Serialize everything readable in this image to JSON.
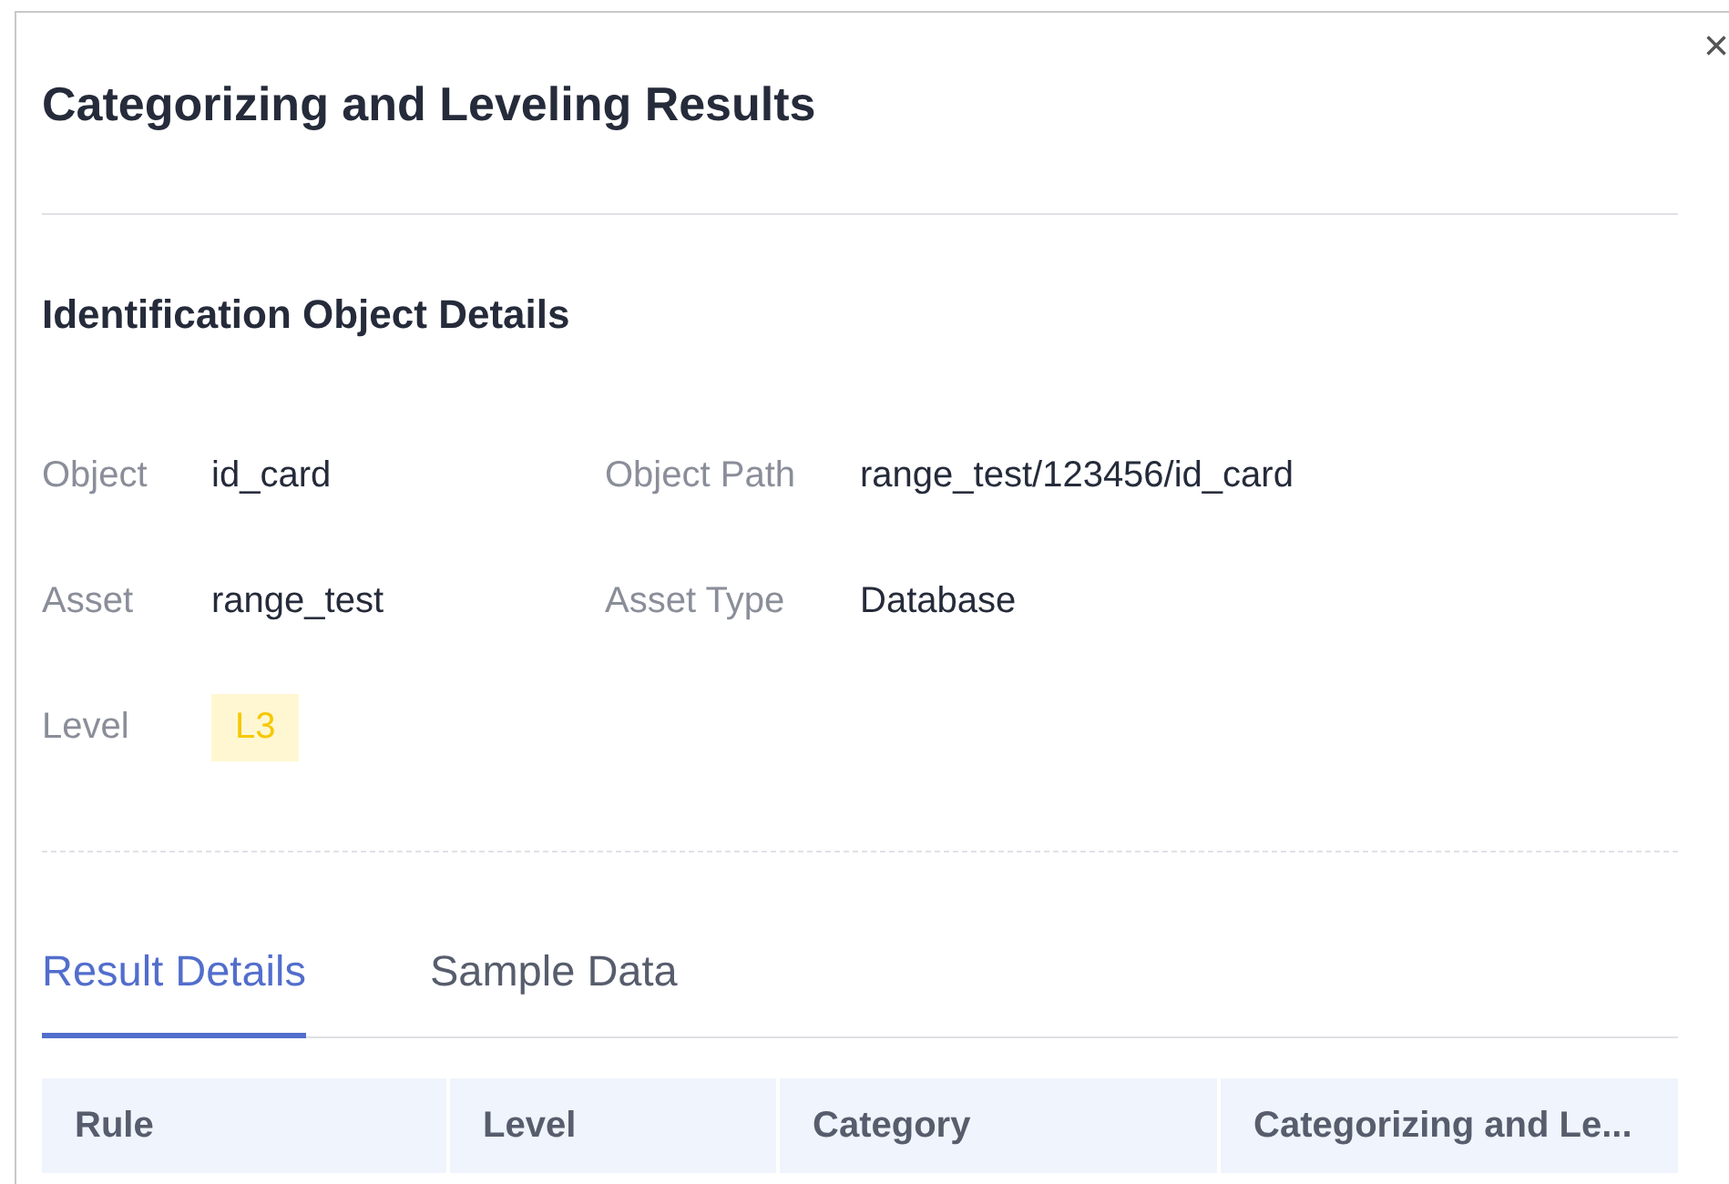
{
  "dialog": {
    "title": "Categorizing and Leveling Results",
    "close": "×"
  },
  "section_title": "Identification Object Details",
  "fields": [
    {
      "label": "Object",
      "value": "id_card",
      "kind": "text"
    },
    {
      "label": "Object Path",
      "value": "range_test/123456/id_card",
      "kind": "text"
    },
    {
      "label": "Asset",
      "value": "range_test",
      "kind": "text"
    },
    {
      "label": "Asset Type",
      "value": "Database",
      "kind": "text"
    },
    {
      "label": "Level",
      "value": "L3",
      "kind": "tag",
      "color": "#f5c800"
    }
  ],
  "tabs": [
    {
      "label": "Result Details",
      "selected": true
    },
    {
      "label": "Sample Data",
      "selected": false
    }
  ],
  "table": {
    "columns": [
      "Rule",
      "Level",
      "Category",
      "Categorizing and Le..."
    ]
  }
}
